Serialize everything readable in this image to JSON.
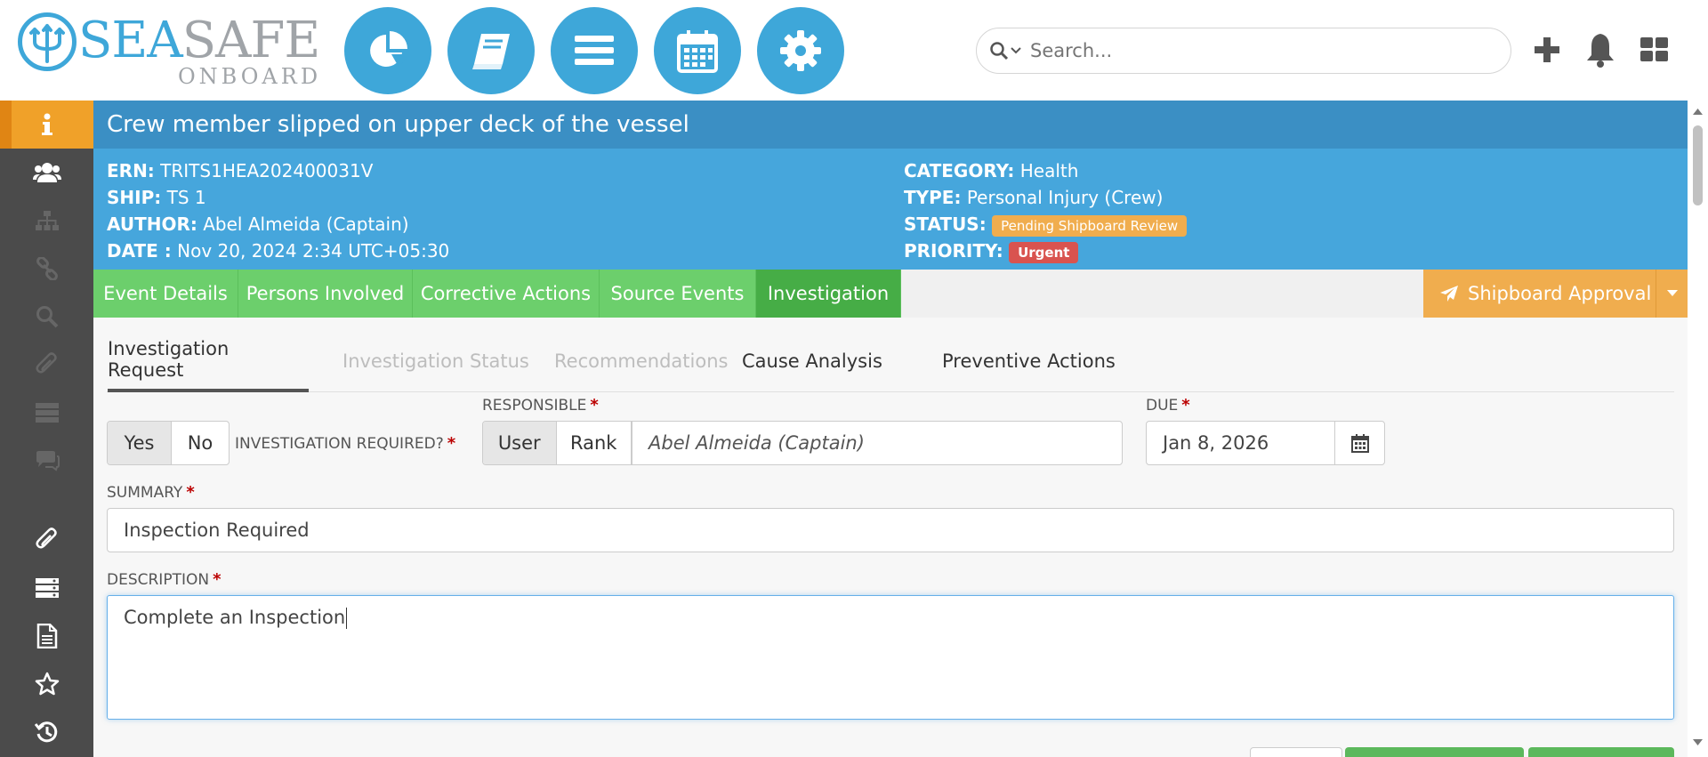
{
  "header": {
    "logo": {
      "sea": "SEA",
      "safe": "SAFE",
      "onboard": "ONBOARD"
    },
    "nav_icons": [
      "pie-chart-icon",
      "book-icon",
      "menu-icon",
      "calendar-icon",
      "gear-icon"
    ],
    "search": {
      "placeholder": "Search..."
    },
    "right_icons": [
      "plus-icon",
      "bell-icon",
      "grid-icon"
    ],
    "accent": "#3ea7d9"
  },
  "sidebar": {
    "items": [
      "info-icon",
      "users-icon",
      "sitemap-icon",
      "link-icon",
      "search-icon",
      "paperclip-icon",
      "server-icon",
      "comments-icon",
      "paperclip-icon",
      "server-icon",
      "document-icon",
      "star-icon",
      "history-icon"
    ]
  },
  "event": {
    "title": "Crew member slipped on upper deck of the vessel",
    "ern_label": "ERN:",
    "ern": "TRITS1HEA202400031V",
    "ship_label": "SHIP:",
    "ship": "TS 1",
    "author_label": "AUTHOR:",
    "author": "Abel Almeida (Captain)",
    "date_label": "DATE :",
    "date": "Nov 20, 2024 2:34 UTC+05:30",
    "category_label": "CATEGORY:",
    "category": "Health",
    "type_label": "TYPE:",
    "type": "Personal Injury (Crew)",
    "status_label": "STATUS:",
    "status": "Pending Shipboard Review",
    "priority_label": "PRIORITY:",
    "priority": "Urgent"
  },
  "tabs": [
    "Event Details",
    "Persons Involved",
    "Corrective Actions",
    "Source Events",
    "Investigation"
  ],
  "active_tab": "Investigation",
  "approval": {
    "label": "Shipboard Approval"
  },
  "subtabs": [
    "Investigation Request",
    "Investigation Status",
    "Recommendations",
    "Cause Analysis",
    "Preventive Actions"
  ],
  "form": {
    "yes": "Yes",
    "no": "No",
    "investigation_required_label": "INVESTIGATION REQUIRED?",
    "responsible_label": "RESPONSIBLE",
    "user": "User",
    "rank": "Rank",
    "responsible_value": "Abel Almeida (Captain)",
    "due_label": "DUE",
    "due_value": "Jan 8, 2026",
    "summary_label": "SUMMARY",
    "summary_value": "Inspection Required",
    "description_label": "DESCRIPTION",
    "description_value": "Complete an Inspection",
    "required_mark": "*"
  }
}
